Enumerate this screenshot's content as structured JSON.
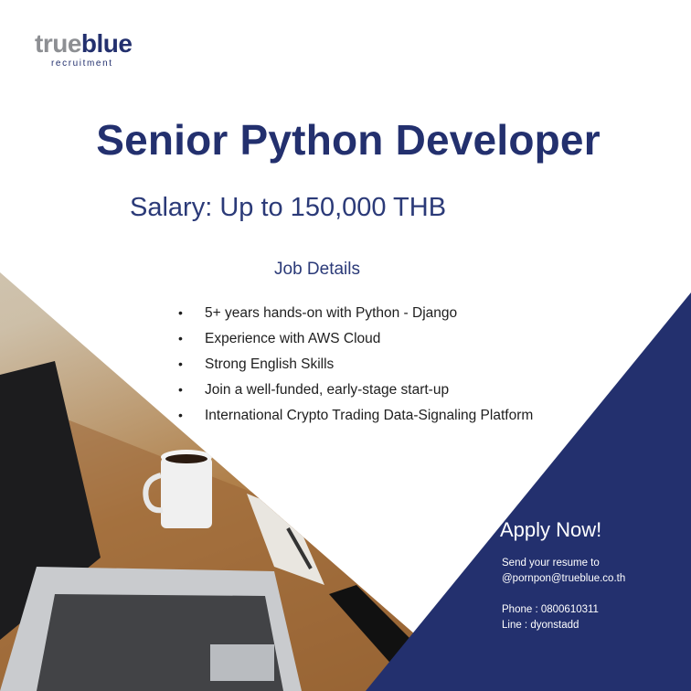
{
  "logo": {
    "word_true": "true",
    "word_blue": "blue",
    "sub": "recruitment"
  },
  "title": "Senior Python Developer",
  "salary": "Salary: Up to 150,000 THB",
  "details_heading": "Job Details",
  "bullet_glyph": "•",
  "bullets": [
    "5+ years hands-on with Python - Django",
    "Experience with AWS Cloud",
    "Strong English Skills",
    "Join a well-funded, early-stage start-up",
    "International Crypto Trading Data-Signaling Platform"
  ],
  "apply": {
    "heading": "Apply Now!",
    "line1": "Send your resume to",
    "email": "@pornpon@trueblue.co.th",
    "phone": "Phone : 0800610311",
    "line_id": "Line : dyonstadd"
  },
  "colors": {
    "navy": "#23306e",
    "logo_gray": "#8d8f93"
  }
}
